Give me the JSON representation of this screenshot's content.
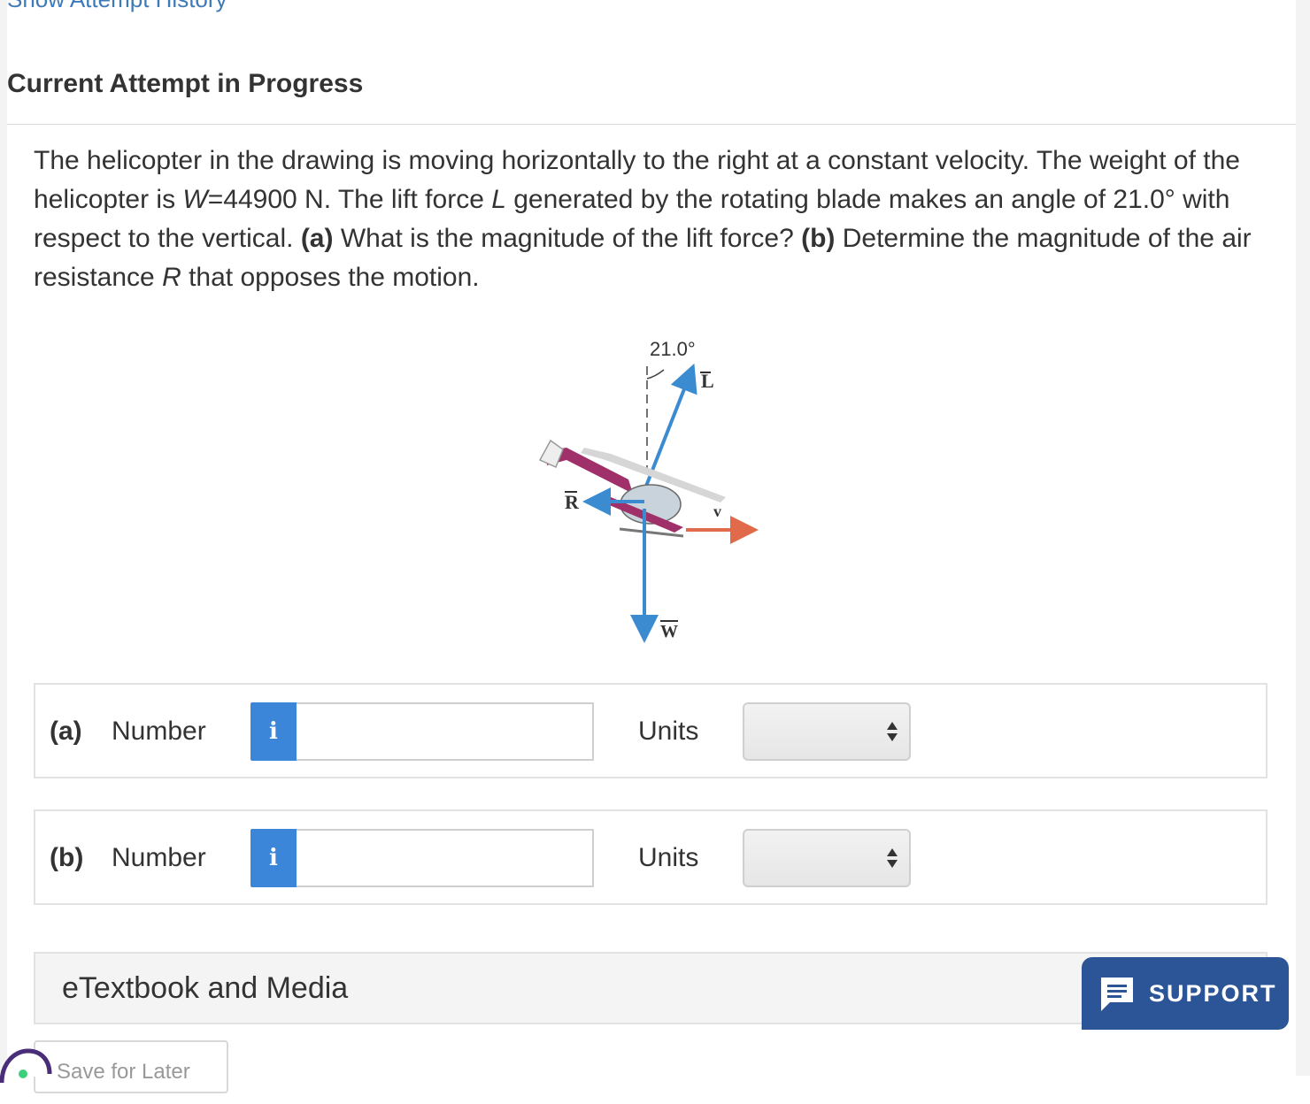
{
  "top_link": "Show Attempt History",
  "attempt_title": "Current Attempt in Progress",
  "question": {
    "t1": "The helicopter in the drawing is moving horizontally to the right at a constant velocity. The weight of the helicopter is ",
    "w_symbol": "W",
    "t2": "=44900 N. The lift force ",
    "l_symbol": "L",
    "t3": " generated by the rotating blade makes an angle of 21.0° with respect to the vertical. ",
    "part_a_tag": "(a)",
    "t4": " What is the magnitude of the lift force? ",
    "part_b_tag": "(b)",
    "t5": " Determine the magnitude of the air resistance ",
    "r_symbol": "R",
    "t6": " that opposes the motion."
  },
  "figure": {
    "angle_label": "21.0°",
    "lift_label": "L",
    "resistance_label": "R",
    "velocity_label": "v",
    "weight_label": "W",
    "colors": {
      "force_arrow": "#3b8bd0",
      "velocity_arrow": "#e06a4a",
      "helicopter_body": "#a0306a"
    }
  },
  "answers": [
    {
      "part": "(a)",
      "number_label": "Number",
      "info_icon": "i",
      "number_value": "",
      "units_label": "Units",
      "units_value": ""
    },
    {
      "part": "(b)",
      "number_label": "Number",
      "info_icon": "i",
      "number_value": "",
      "units_label": "Units",
      "units_value": ""
    }
  ],
  "etextbook_label": "eTextbook and Media",
  "support_label": "SUPPORT",
  "save_later_label": "Save for Later",
  "accent_color": "#3b86d8",
  "support_color": "#2b5596"
}
